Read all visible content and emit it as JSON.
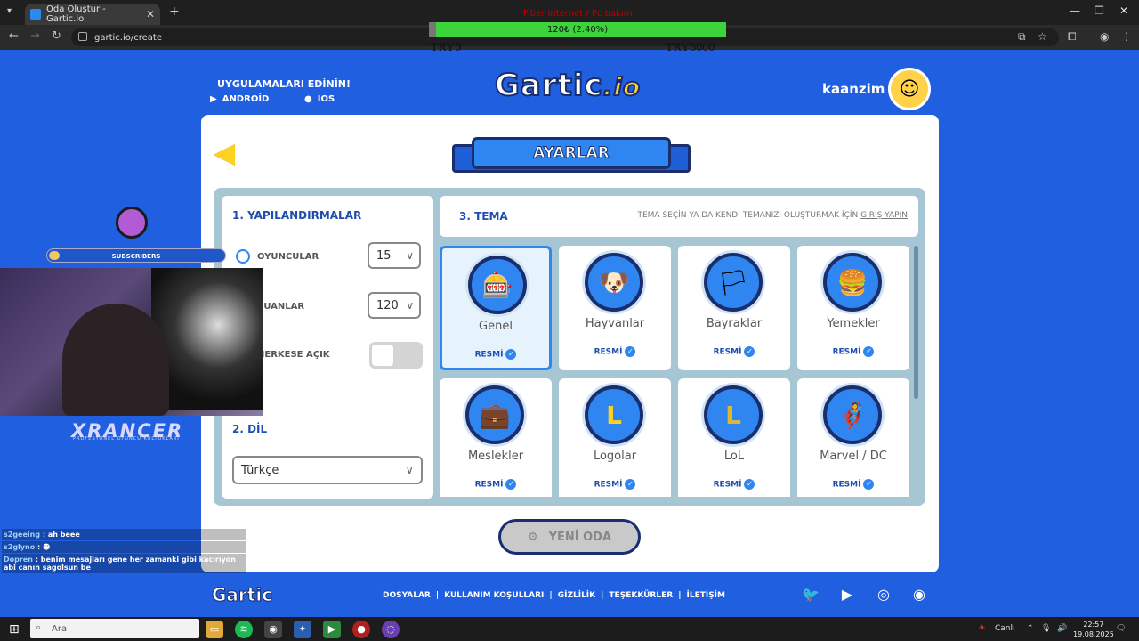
{
  "browser": {
    "tab_title": "Oda Oluştur - Gartic.io",
    "url": "gartic.io/create"
  },
  "overlay": {
    "goal_title": "Fiber internet / Pc bakım",
    "progress_text": "120₺ (2.40%)",
    "progress_fraction": 0.024,
    "start_label": "TRY0",
    "end_label": "TRY5000",
    "subscribers_label": "SUBSCRIBERS",
    "brand": "XRANCER",
    "brand_sub": "PROFESYONEL OYUNCU KOLTUKLARI",
    "chat": [
      {
        "user": "s2geeing",
        "msg": "ah beee"
      },
      {
        "user": "s2glyno",
        "msg": ""
      },
      {
        "user": "Dopren",
        "msg": "benim mesajları gene her zamanki gibi kacırıyon abi canın sagolsun be"
      }
    ]
  },
  "header": {
    "apps_title": "UYGULAMALARI EDİNİN!",
    "android_label": "ANDROİD",
    "ios_label": "IOS",
    "logo": "Gartic",
    "logo_io": ".io",
    "username": "kaanzim"
  },
  "settings": {
    "title": "AYARLAR",
    "configs_title": "1. YAPILANDIRMALAR",
    "players_label": "OYUNCULAR",
    "players_value": "15",
    "points_label": "PUANLAR",
    "points_value": "120",
    "public_label": "HERKESE AÇIK",
    "language_title": "2. DİL",
    "language_value": "Türkçe",
    "theme_title": "3. TEMA",
    "theme_hint": "TEMA SEÇİN YA DA KENDİ TEMANIZI OLUŞTURMAK İÇİN",
    "theme_hint_link": "GİRİŞ YAPIN",
    "official_label": "RESMİ",
    "themes": [
      {
        "name": "Genel",
        "icon": "🎰"
      },
      {
        "name": "Hayvanlar",
        "icon": "🐶"
      },
      {
        "name": "Bayraklar",
        "icon": "🏳"
      },
      {
        "name": "Yemekler",
        "icon": "🍔"
      },
      {
        "name": "Meslekler",
        "icon": "💼"
      },
      {
        "name": "Logolar",
        "icon": "L"
      },
      {
        "name": "LoL",
        "icon": "L"
      },
      {
        "name": "Marvel / DC",
        "icon": "🦸"
      }
    ],
    "new_room_label": "YENİ ODA"
  },
  "footer": {
    "logo": "Gartic",
    "links": [
      "DOSYALAR",
      "KULLANIM KOŞULLARI",
      "GİZLİLİK",
      "TEŞEKKÜRLER",
      "İLETİŞİM"
    ]
  },
  "taskbar": {
    "search_placeholder": "Ara",
    "live_label": "Canlı",
    "time": "22:57",
    "date": "19.08.2025"
  }
}
